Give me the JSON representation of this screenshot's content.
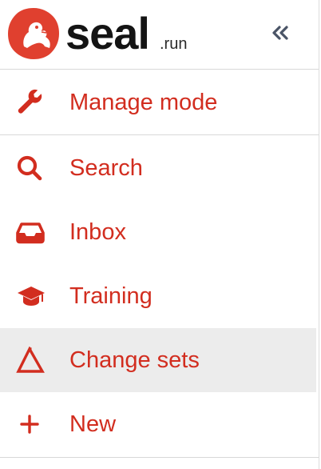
{
  "brand": {
    "name": "seal",
    "tld": ".run",
    "accent": "#d22d1f",
    "badge_color": "#e0402f"
  },
  "header": {
    "collapse_icon": "double-chevron-left-icon"
  },
  "manage": {
    "label": "Manage mode",
    "icon": "wrench-icon"
  },
  "nav": {
    "items": [
      {
        "label": "Search",
        "icon": "search-icon"
      },
      {
        "label": "Inbox",
        "icon": "inbox-icon"
      },
      {
        "label": "Training",
        "icon": "graduation-cap-icon"
      },
      {
        "label": "Change sets",
        "icon": "delta-icon",
        "active": true
      },
      {
        "label": "New",
        "icon": "plus-icon"
      }
    ]
  }
}
